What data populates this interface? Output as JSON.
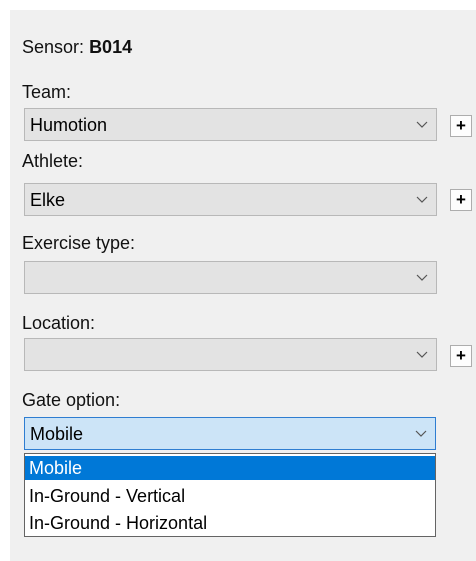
{
  "sensor": {
    "label": "Sensor:",
    "id": "B014"
  },
  "team": {
    "label": "Team:",
    "value": "Humotion",
    "add_label": "+"
  },
  "athlete": {
    "label": "Athlete:",
    "value": "Elke",
    "add_label": "+"
  },
  "exercise_type": {
    "label": "Exercise type:",
    "value": ""
  },
  "location": {
    "label": "Location:",
    "value": "",
    "add_label": "+"
  },
  "gate_option": {
    "label": "Gate option:",
    "value": "Mobile",
    "options": [
      "Mobile",
      "In-Ground - Vertical",
      "In-Ground - Horizontal"
    ],
    "selected_option": "Mobile"
  },
  "icons": {
    "dropdown_arrow": "chevron-down-icon"
  },
  "colors": {
    "panel_bg": "#f0f0f0",
    "combo_bg": "#e3e3e3",
    "focus_bg": "#cce4f7",
    "focus_border": "#2e7dd1",
    "selection_bg": "#0078d7"
  }
}
